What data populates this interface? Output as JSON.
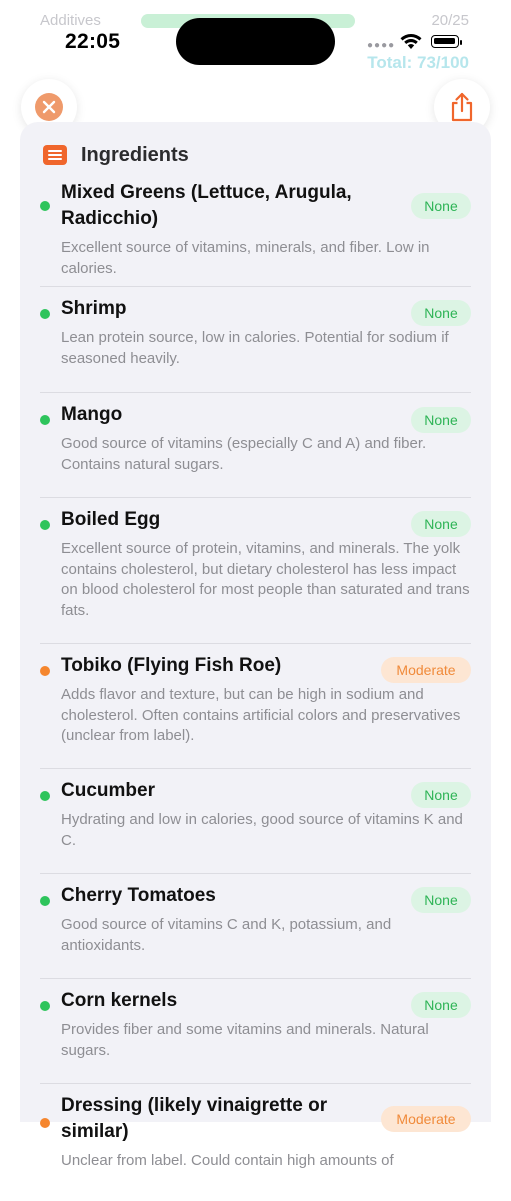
{
  "background": {
    "label": "Additives",
    "count": "20/25",
    "total": "Total: 73/100"
  },
  "status_bar": {
    "time": "22:05",
    "icons": [
      "signal-dots-icon",
      "wifi-icon",
      "battery-icon"
    ]
  },
  "header": {
    "close_icon": "close-icon",
    "share_icon": "share-icon",
    "section_icon": "list-icon",
    "title": "Ingredients"
  },
  "colors": {
    "accent": "#f0662c",
    "none_badge_text": "#2eb456",
    "none_badge_bg": "#dcf4e4",
    "moderate_badge_text": "#f08a3a",
    "moderate_badge_bg": "#fde6d3",
    "dot_green": "#2ec45c",
    "dot_orange": "#f5862e"
  },
  "ingredients": [
    {
      "name": "Mixed Greens (Lettuce, Arugula, Radicchio)",
      "badge": "None",
      "level": "none",
      "description": "Excellent source of vitamins, minerals, and fiber. Low in calories."
    },
    {
      "name": "Shrimp",
      "badge": "None",
      "level": "none",
      "description": "Lean protein source, low in calories. Potential for sodium if seasoned heavily."
    },
    {
      "name": "Mango",
      "badge": "None",
      "level": "none",
      "description": "Good source of vitamins (especially C and A) and fiber. Contains natural sugars."
    },
    {
      "name": "Boiled Egg",
      "badge": "None",
      "level": "none",
      "description": "Excellent source of protein, vitamins, and minerals. The yolk contains cholesterol, but dietary cholesterol has less impact on blood cholesterol for most people than saturated and trans fats."
    },
    {
      "name": "Tobiko (Flying Fish Roe)",
      "badge": "Moderate",
      "level": "moderate",
      "description": "Adds flavor and texture, but can be high in sodium and cholesterol. Often contains artificial colors and preservatives (unclear from label)."
    },
    {
      "name": "Cucumber",
      "badge": "None",
      "level": "none",
      "description": "Hydrating and low in calories, good source of vitamins K and C."
    },
    {
      "name": "Cherry Tomatoes",
      "badge": "None",
      "level": "none",
      "description": "Good source of vitamins C and K, potassium, and antioxidants."
    },
    {
      "name": "Corn kernels",
      "badge": "None",
      "level": "none",
      "description": "Provides fiber and some vitamins and minerals. Natural sugars."
    },
    {
      "name": "Dressing (likely vinaigrette or similar)",
      "badge": "Moderate",
      "level": "moderate",
      "description": "Unclear from label. Could contain high amounts of"
    }
  ]
}
